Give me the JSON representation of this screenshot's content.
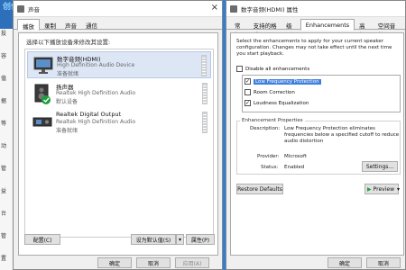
{
  "background": {
    "app_title": "创作中心",
    "left_items": [
      "投",
      "容",
      "值",
      "据",
      "等",
      "动",
      "管",
      "益",
      "台",
      "管",
      "置"
    ]
  },
  "sound": {
    "title": "声音",
    "tabs": [
      "播放",
      "录制",
      "声音",
      "通信"
    ],
    "hint": "选择以下播放设备来修改其设置:",
    "devices": [
      {
        "name": "数字音频(HDMI)",
        "desc": "High Definition Audio Device",
        "state": "准备就绪",
        "icon": "monitor-icon",
        "selected": true
      },
      {
        "name": "扬声器",
        "desc": "Realtek High Definition Audio",
        "state": "默认设备",
        "icon": "speaker-icon",
        "default": true
      },
      {
        "name": "Realtek Digital Output",
        "desc": "Realtek High Definition Audio",
        "state": "准备就绪",
        "icon": "digital-output-icon"
      }
    ],
    "configure_label": "配置(C)",
    "set_default_label": "设为默认值(S)",
    "properties_label": "属性(P)",
    "ok_label": "确定",
    "cancel_label": "取消",
    "apply_label": "应用(A)"
  },
  "props": {
    "title": "数字音频(HDMI) 属性",
    "tabs": [
      "常规",
      "支持的格式",
      "级别",
      "Enhancements",
      "高级",
      "空间音效"
    ],
    "active_tab": "Enhancements",
    "intro": "Select the enhancements to apply for your current speaker configuration. Changes may not take effect until the next time you start playback.",
    "disable_all_label": "Disable all enhancements",
    "enhancements": [
      {
        "label": "Low Frequency Protection",
        "checked": true,
        "highlighted": true
      },
      {
        "label": "Room Correction",
        "checked": false
      },
      {
        "label": "Loudness Equalization",
        "checked": true
      }
    ],
    "group_title": "Enhancement Properties",
    "description_label": "Description:",
    "description_text": "Low Frequency Protection eliminates frequencies below a specified cutoff to reduce audio distortion",
    "provider_label": "Provider:",
    "provider_value": "Microsoft",
    "status_label": "Status:",
    "status_value": "Enabled",
    "settings_label": "Settings...",
    "restore_label": "Restore Defaults",
    "preview_label": "Preview",
    "ok_label": "确定",
    "cancel_label": "取消"
  }
}
